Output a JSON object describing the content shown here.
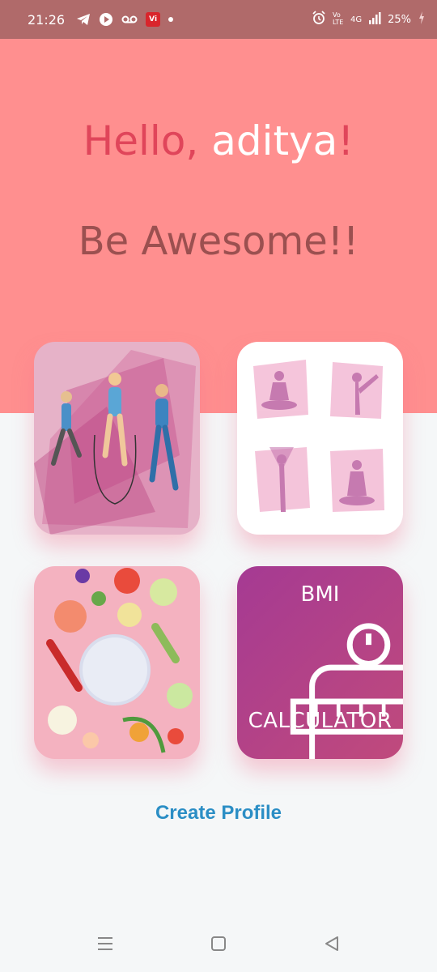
{
  "status_bar": {
    "time": "21:26",
    "battery": "25%",
    "network_label": "4G",
    "vi_label": "Vi",
    "icons": [
      "telegram-icon",
      "play-icon",
      "voicemail-icon",
      "vi-app-icon",
      "dot-icon",
      "alarm-icon",
      "volte-icon",
      "signal-icon",
      "battery-icon"
    ]
  },
  "header": {
    "hello": "Hello,",
    "name": "aditya",
    "exclaim": "!",
    "tagline": "Be Awesome!!"
  },
  "cards": {
    "workout": "workout-illustration",
    "yoga": "yoga-poses-illustration",
    "diet": "diet-vegetables-illustration",
    "bmi": {
      "title": "BMI",
      "subtitle": "CALCULATOR"
    }
  },
  "actions": {
    "create_profile": "Create Profile"
  },
  "nav": {
    "items": [
      "menu-icon",
      "home-icon",
      "back-icon"
    ]
  },
  "colors": {
    "header_bg": "#ff8f8f",
    "status_bg": "#b06a6a",
    "link": "#2b8ec5",
    "bmi_gradient_start": "#a53a93",
    "bmi_gradient_end": "#c04a7c"
  }
}
